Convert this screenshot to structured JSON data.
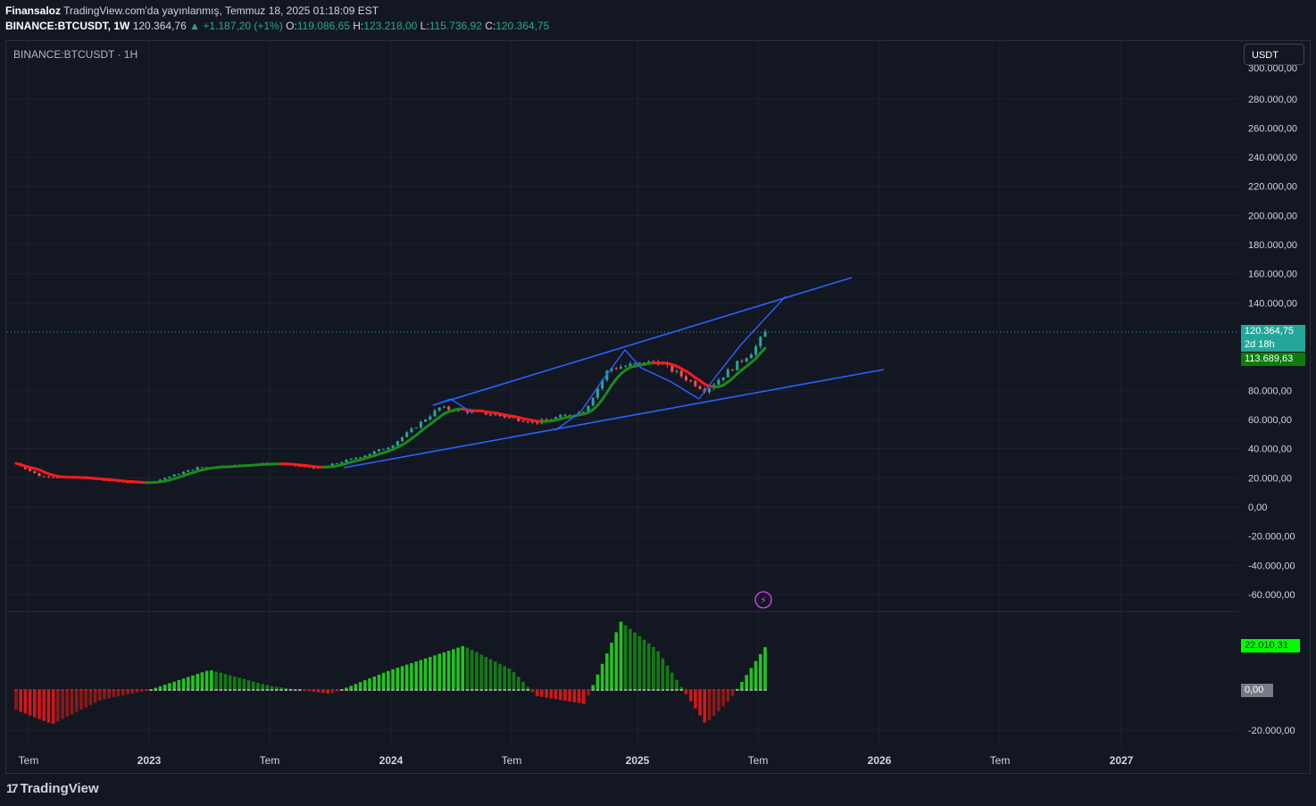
{
  "header": {
    "publisher": "Finansaloz",
    "published_text": "TradingView.com'da yayınlanmış, Temmuz 18, 2025 01:18:09 EST",
    "symbol_interval": "BINANCE:BTCUSDT, 1W",
    "last_price": "120.364,76",
    "change": "+1.187,20 (+1%)",
    "open_label": "O:",
    "open": "119.086,65",
    "high_label": "H:",
    "high": "123.218,00",
    "low_label": "L:",
    "low": "115.736,92",
    "close_label": "C:",
    "close": "120.364,75"
  },
  "chart_label": "BINANCE:BTCUSDT · 1H",
  "currency": "USDT",
  "footer_logo": "TradingView",
  "colors": {
    "background": "#131722",
    "up": "#26a69a",
    "down": "#ef5350",
    "trendline": "#2962ff",
    "ma_up": "#1b8a1b",
    "ma_down": "#ff1a1a"
  },
  "price_scale": {
    "top_label": "300.000,00",
    "labels": [
      "280.000,00",
      "260.000,00",
      "240.000,00",
      "220.000,00",
      "200.000,00",
      "180.000,00",
      "160.000,00",
      "140.000,00",
      "80.000,00",
      "60.000,00",
      "40.000,00",
      "20.000,00",
      "0,00",
      "-20.000,00",
      "-40.000,00",
      "-60.000,00"
    ],
    "last_price_badge": "120.364,75",
    "countdown_badge": "2d 18h",
    "ma_badge": "113.689,63"
  },
  "indicator_scale": {
    "value_badge": "22.010,31",
    "zero_badge": "0,00",
    "labels": [
      "-20.000,00"
    ]
  },
  "time_axis": [
    "Tem",
    "2023",
    "Tem",
    "2024",
    "Tem",
    "2025",
    "Tem",
    "2026",
    "Tem",
    "2027"
  ],
  "chart_data": {
    "type": "candlestick",
    "symbol": "BINANCE:BTCUSDT",
    "interval": "1W",
    "ylim": [
      -70000,
      300000
    ],
    "price_series_approx": [
      [
        2022.45,
        30000
      ],
      [
        2022.55,
        21000
      ],
      [
        2022.7,
        20000
      ],
      [
        2022.9,
        17000
      ],
      [
        2023.0,
        16500
      ],
      [
        2023.2,
        27000
      ],
      [
        2023.5,
        30000
      ],
      [
        2023.7,
        26500
      ],
      [
        2023.9,
        36000
      ],
      [
        2024.0,
        42000
      ],
      [
        2024.2,
        68000
      ],
      [
        2024.4,
        64000
      ],
      [
        2024.6,
        58000
      ],
      [
        2024.8,
        66000
      ],
      [
        2024.9,
        95000
      ],
      [
        2025.1,
        100000
      ],
      [
        2025.3,
        80000
      ],
      [
        2025.4,
        94000
      ],
      [
        2025.5,
        108000
      ],
      [
        2025.55,
        120365
      ]
    ],
    "oscillator_series_approx": [
      [
        2022.45,
        -10000
      ],
      [
        2022.6,
        -17000
      ],
      [
        2022.8,
        -5000
      ],
      [
        2023.0,
        0
      ],
      [
        2023.25,
        10000
      ],
      [
        2023.5,
        2000
      ],
      [
        2023.75,
        -2000
      ],
      [
        2024.0,
        10000
      ],
      [
        2024.3,
        22000
      ],
      [
        2024.5,
        10000
      ],
      [
        2024.6,
        -3000
      ],
      [
        2024.8,
        -7000
      ],
      [
        2024.95,
        34000
      ],
      [
        2025.1,
        20000
      ],
      [
        2025.3,
        -17000
      ],
      [
        2025.4,
        -5000
      ],
      [
        2025.55,
        22010
      ]
    ],
    "oscillator_last": 22010.31,
    "trendlines": "rising channel with upper and lower lines"
  }
}
